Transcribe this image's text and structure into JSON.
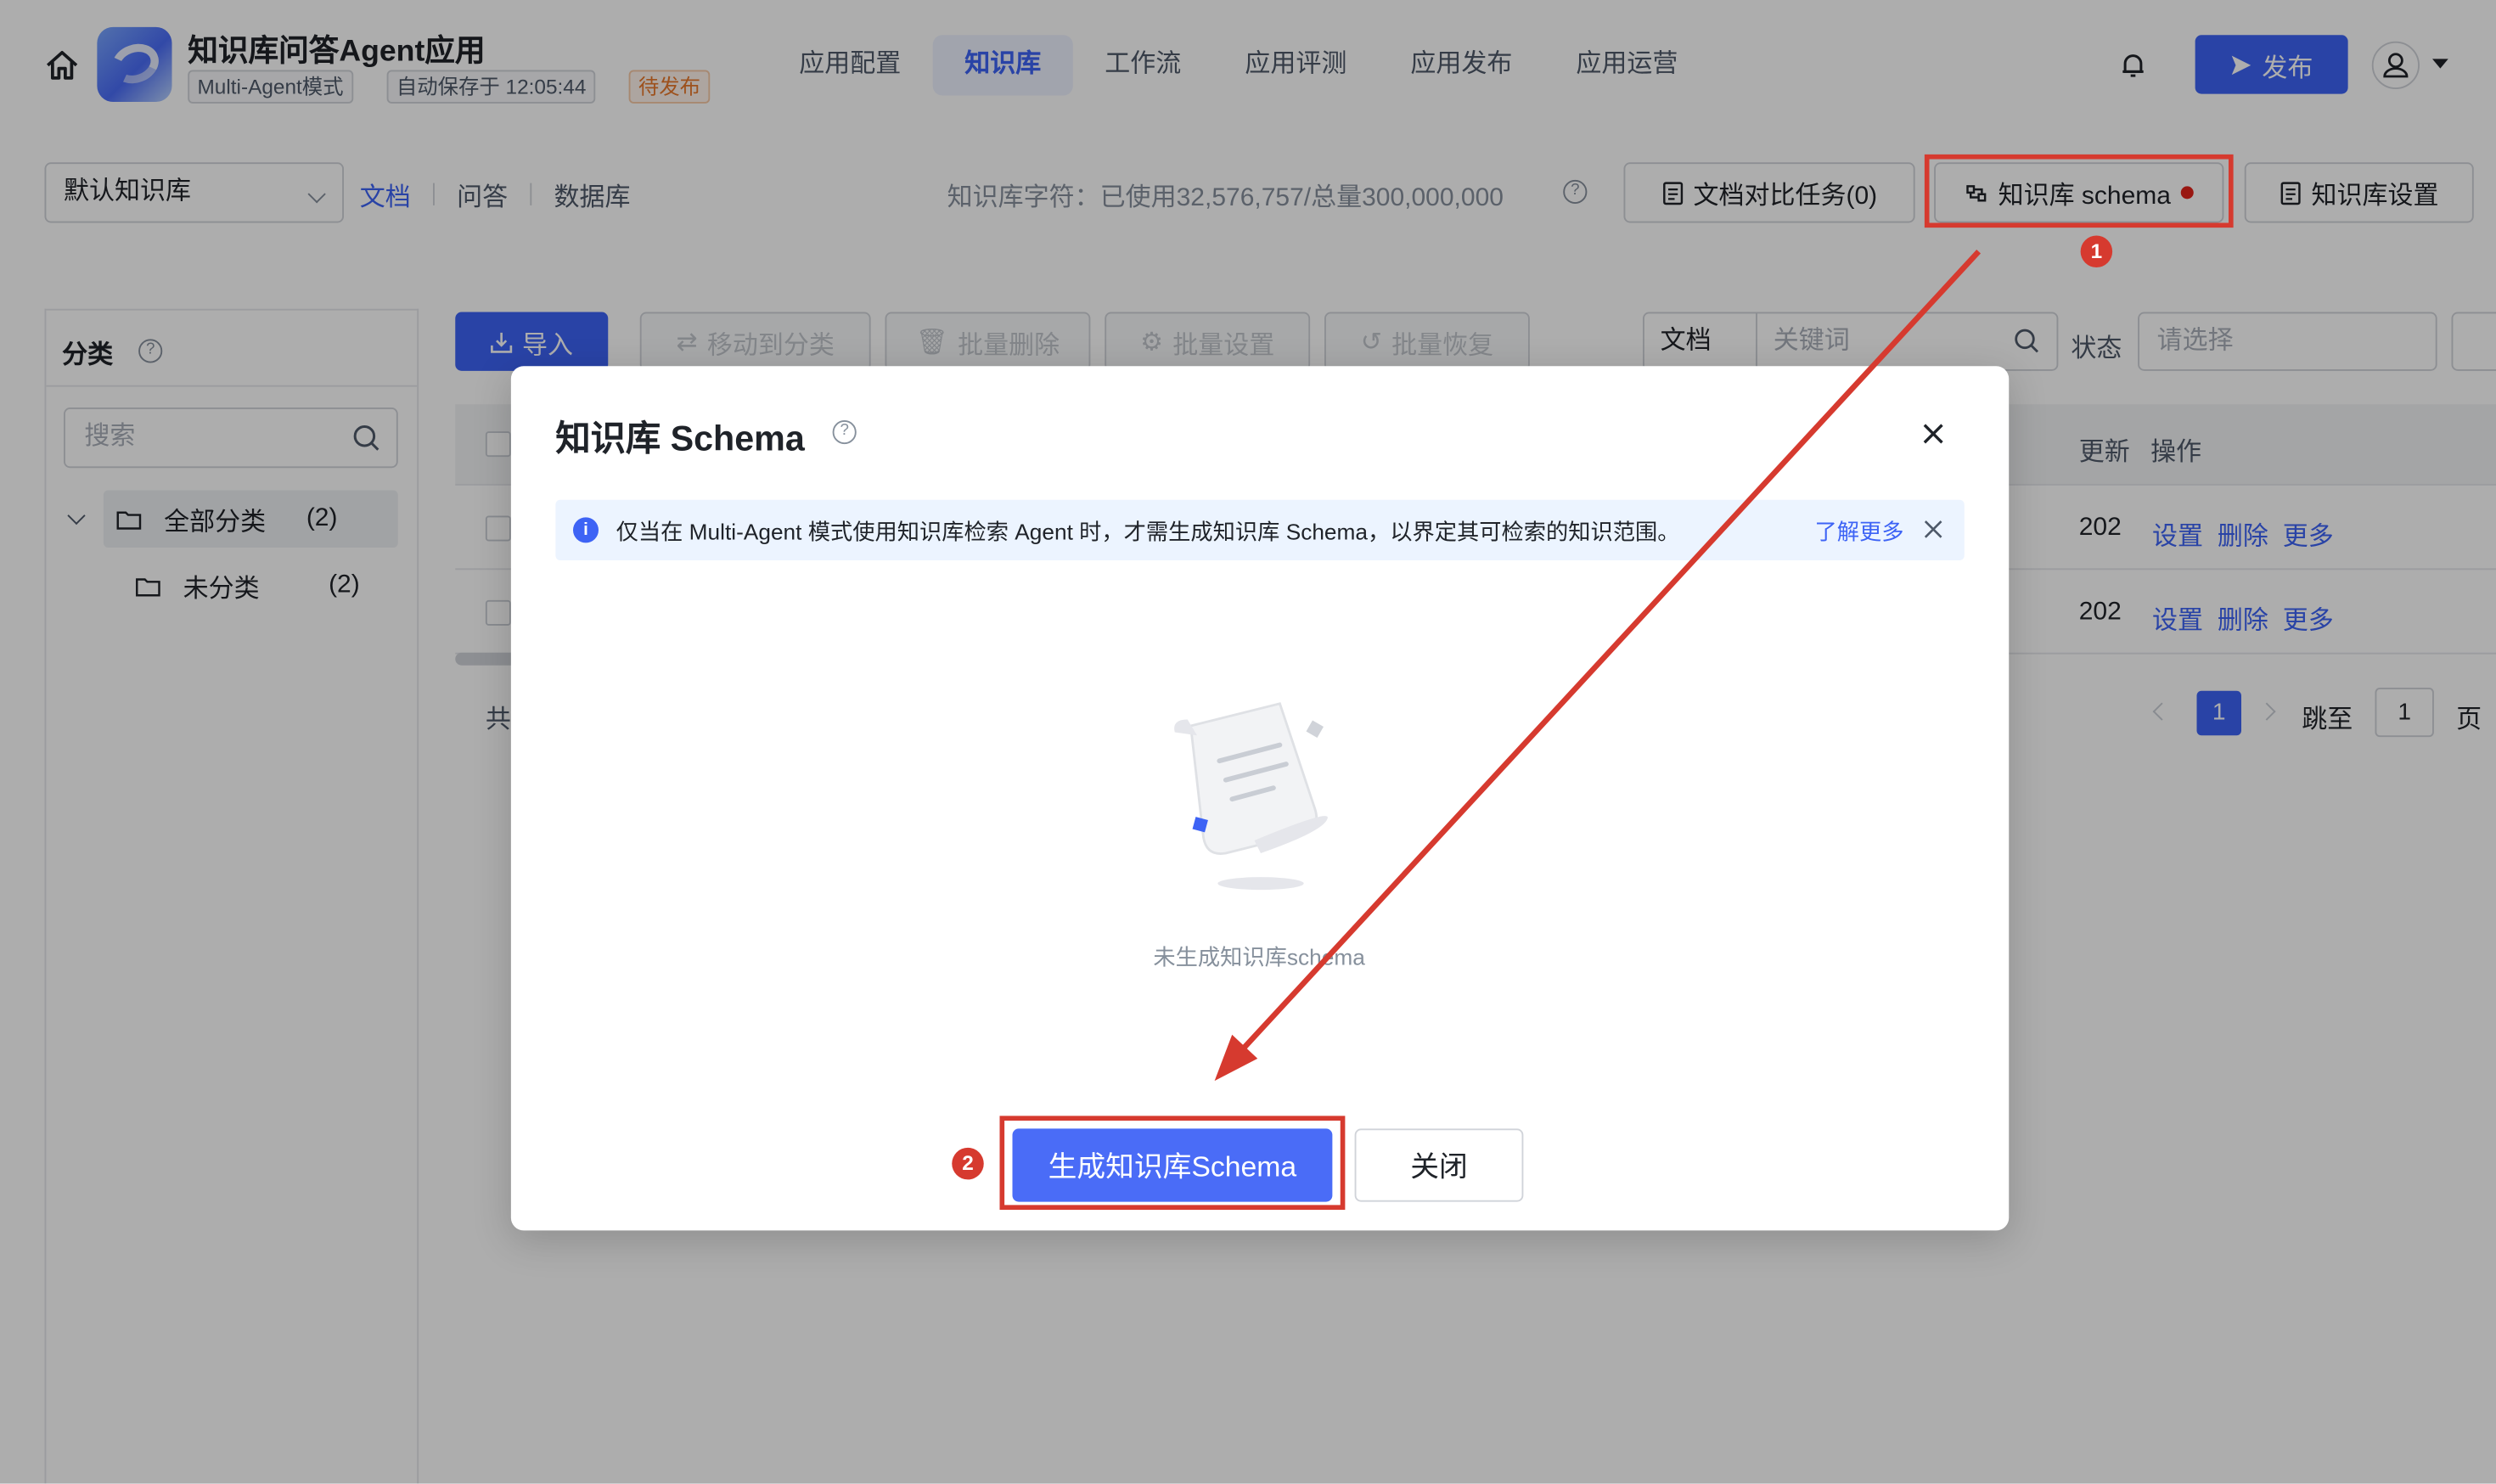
{
  "header": {
    "app_title": "知识库问答Agent应用",
    "tags": {
      "mode": "Multi-Agent模式",
      "saved": "自动保存于 12:05:44",
      "pending": "待发布"
    },
    "nav": [
      "应用配置",
      "知识库",
      "工作流",
      "应用评测",
      "应用发布",
      "应用运营"
    ],
    "active_nav": "知识库",
    "publish_label": "发布",
    "icons": {
      "home": "home-icon",
      "bell": "bell-icon",
      "user": "user-icon"
    }
  },
  "toolbar": {
    "kb_select": "默认知识库",
    "sub_tabs": [
      "文档",
      "问答",
      "数据库"
    ],
    "usage": "知识库字符：已使用32,576,757/总量300,000,000",
    "compare_label": "文档对比任务(0)",
    "schema_label": "知识库 schema",
    "settings_label": "知识库设置"
  },
  "left_panel": {
    "title": "分类",
    "search_placeholder": "搜索",
    "tree": [
      {
        "label": "全部分类",
        "count": "(2)"
      },
      {
        "label": "未分类",
        "count": "(2)"
      }
    ]
  },
  "content": {
    "actions": {
      "import": "导入",
      "move": "移动到分类",
      "batch_delete": "批量删除",
      "batch_set": "批量设置",
      "batch_restore": "批量恢复"
    },
    "filter": {
      "type": "文档",
      "keyword_placeholder": "关键词",
      "status_label": "状态",
      "status_placeholder": "请选择"
    },
    "table": {
      "headers": {
        "updated": "更新",
        "ops": "操作"
      },
      "rows": [
        {
          "updated": "202",
          "ops": [
            "设置",
            "删除",
            "更多"
          ]
        },
        {
          "updated": "202",
          "ops": [
            "设置",
            "删除",
            "更多"
          ]
        }
      ]
    },
    "total_prefix": "共",
    "pager": {
      "current": "1",
      "jump_label": "跳至",
      "jump_value": "1",
      "page_label": "页"
    }
  },
  "modal": {
    "title": "知识库 Schema",
    "info": "仅当在 Multi-Agent 模式使用知识库检索 Agent 时，才需生成知识库 Schema，以界定其可检索的知识范围。",
    "info_link": "了解更多",
    "empty_text": "未生成知识库schema",
    "primary_label": "生成知识库Schema",
    "secondary_label": "关闭"
  },
  "annotations": {
    "badge_1": "1",
    "badge_2": "2"
  },
  "colors": {
    "accent": "#3d63f5",
    "annotation": "#d63a2f",
    "pending": "#e8782c"
  }
}
